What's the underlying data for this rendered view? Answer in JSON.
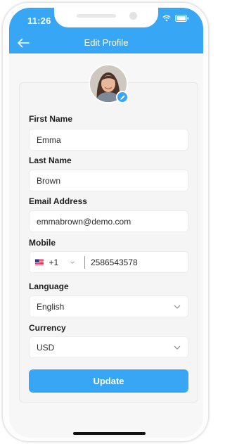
{
  "status_bar": {
    "time": "11:26"
  },
  "header": {
    "title": "Edit Profile"
  },
  "form": {
    "first_name": {
      "label": "First Name",
      "value": "Emma"
    },
    "last_name": {
      "label": "Last Name",
      "value": "Brown"
    },
    "email": {
      "label": "Email Address",
      "value": "emmabrown@demo.com"
    },
    "mobile": {
      "label": "Mobile",
      "country_code": "+1",
      "number": "2586543578"
    },
    "language": {
      "label": "Language",
      "value": "English"
    },
    "currency": {
      "label": "Currency",
      "value": "USD"
    },
    "update_label": "Update"
  },
  "colors": {
    "accent": "#37a6f4"
  },
  "icons": {
    "back": "arrow-left-icon",
    "edit": "pencil-icon",
    "flag": "us-flag-icon",
    "dropdown": "chevron-down-icon"
  }
}
